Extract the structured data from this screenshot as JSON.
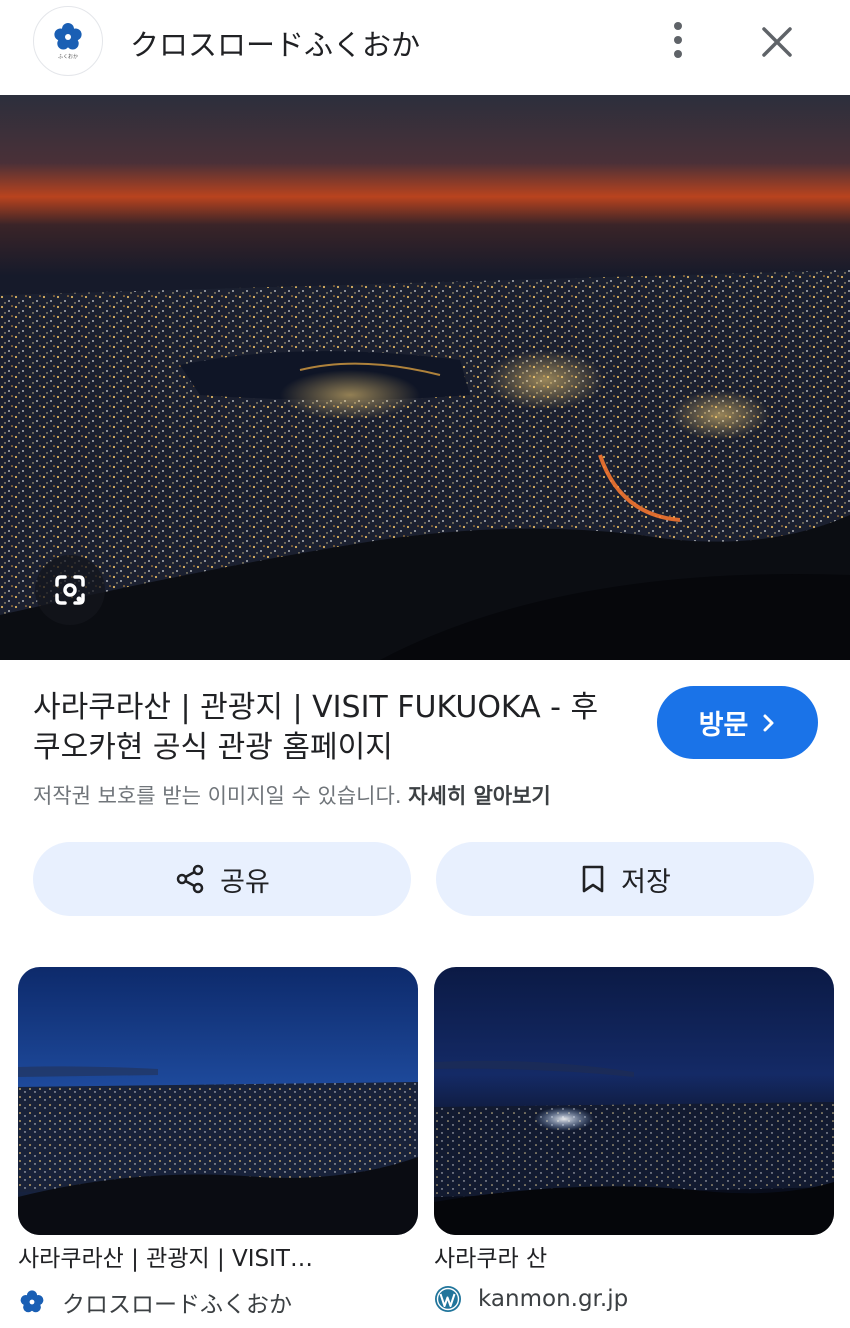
{
  "header": {
    "site_name": "クロスロードふくおか",
    "logo_icon": "crossroad-fukuoka-logo-icon",
    "more_icon": "more-vert-icon",
    "close_icon": "close-icon"
  },
  "hero": {
    "image": "fukuoka-night-city-view",
    "lens_icon": "google-lens-icon"
  },
  "result": {
    "title": "사라쿠라산 | 관광지 | VISIT FUKUOKA - 후쿠오카현 공식 관광 홈페이지",
    "visit_label": "방문",
    "copyright_notice": "저작권 보호를 받는 이미지일 수 있습니다.",
    "learn_more": "자세히 알아보기"
  },
  "actions": {
    "share_label": "공유",
    "share_icon": "share-icon",
    "save_label": "저장",
    "save_icon": "bookmark-icon"
  },
  "related": [
    {
      "title": "사라쿠라산 | 관광지 | VISIT…",
      "source": "クロスロードふくおか",
      "source_icon": "crossroad-fukuoka-logo-icon"
    },
    {
      "title": "사라쿠라 산",
      "source": "kanmon.gr.jp",
      "source_icon": "wordpress-icon"
    }
  ],
  "colors": {
    "accent": "#1a73e8",
    "action_button_bg": "#e8f0fe",
    "text_primary": "#202124",
    "text_secondary": "#70757a"
  }
}
